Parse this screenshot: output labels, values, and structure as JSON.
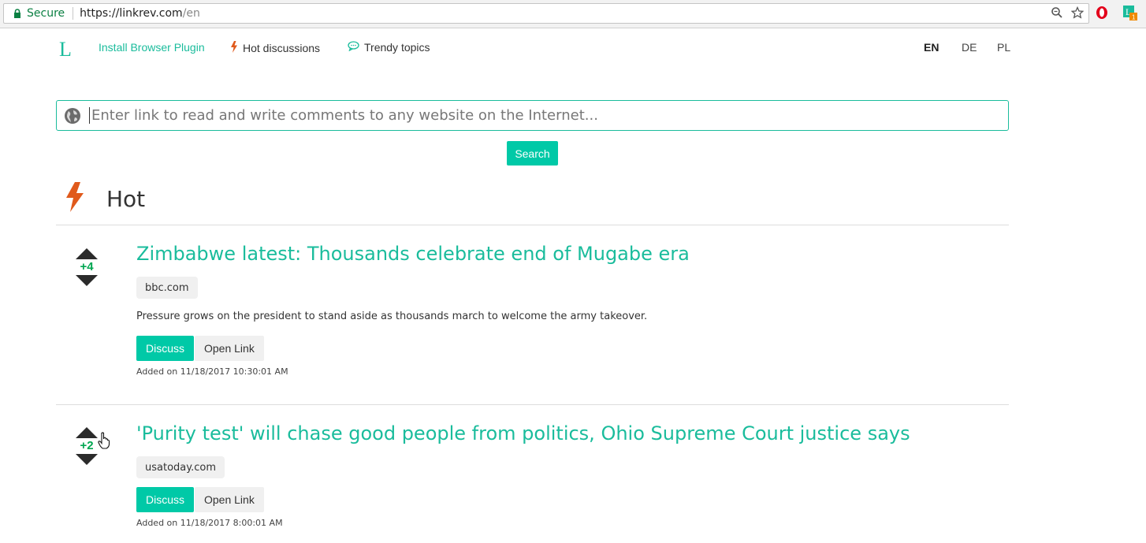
{
  "browser": {
    "secure_label": "Secure",
    "url_host": "https://linkrev.com",
    "url_path": "/en",
    "badge_count": "1"
  },
  "nav": {
    "logo": "L",
    "install_plugin": "Install Browser Plugin",
    "hot_discussions": "Hot discussions",
    "trendy_topics": "Trendy topics",
    "languages": [
      "EN",
      "DE",
      "PL"
    ],
    "active_language": "EN"
  },
  "search": {
    "placeholder": "Enter link to read and write comments to any website on the Internet...",
    "button_label": "Search"
  },
  "section": {
    "title": "Hot"
  },
  "items": [
    {
      "score": "+4",
      "title": "Zimbabwe latest: Thousands celebrate end of Mugabe era",
      "domain": "bbc.com",
      "description": "Pressure grows on the president to stand aside as thousands march to welcome the army takeover.",
      "discuss_label": "Discuss",
      "open_label": "Open Link",
      "added": "Added on 11/18/2017 10:30:01 AM"
    },
    {
      "score": "+2",
      "title": "'Purity test' will chase good people from politics, Ohio Supreme Court justice says",
      "domain": "usatoday.com",
      "description": "",
      "discuss_label": "Discuss",
      "open_label": "Open Link",
      "added": "Added on 11/18/2017 8:00:01 AM"
    }
  ],
  "colors": {
    "accent": "#1abc9c",
    "button": "#00c9a7",
    "hot_icon": "#e05a1c",
    "score": "#00a651"
  }
}
